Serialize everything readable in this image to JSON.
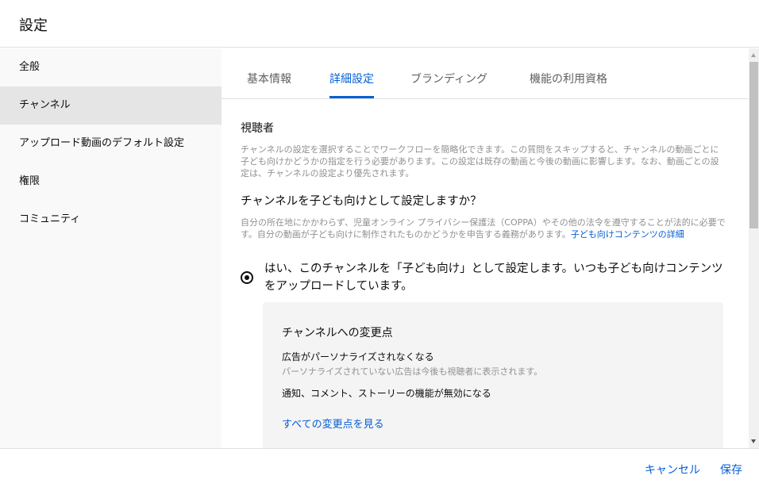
{
  "header": {
    "title": "設定"
  },
  "sidebar": {
    "items": [
      {
        "label": "全般"
      },
      {
        "label": "チャンネル"
      },
      {
        "label": "アップロード動画のデフォルト設定"
      },
      {
        "label": "権限"
      },
      {
        "label": "コミュニティ"
      }
    ],
    "active_index": 1
  },
  "tabs": [
    {
      "label": "基本情報"
    },
    {
      "label": "詳細設定"
    },
    {
      "label": "ブランディング"
    },
    {
      "label": "機能の利用資格"
    }
  ],
  "active_tab_index": 1,
  "audience": {
    "title": "視聴者",
    "description": "チャンネルの設定を選択することでワークフローを簡略化できます。この質問をスキップすると、チャンネルの動画ごとに子ども向けかどうかの指定を行う必要があります。この設定は既存の動画と今後の動画に影響します。なお、動画ごとの設定は、チャンネルの設定より優先されます。",
    "question": "チャンネルを子ども向けとして設定しますか？",
    "coppa_description": "自分の所在地にかかわらず、児童オンライン プライバシー保護法（COPPA）やその他の法令を遵守することが法的に必要です。自分の動画が子ども向けに制作されたものかどうかを申告する義務があります。",
    "coppa_link": "子ども向けコンテンツの詳細",
    "option_yes_label": "はい、このチャンネルを「子ども向け」として設定します。いつも子ども向けコンテンツをアップロードしています。",
    "option_yes_selected": true
  },
  "changes": {
    "title": "チャンネルへの変更点",
    "items": [
      {
        "title": "広告がパーソナライズされなくなる",
        "subtitle": "パーソナライズされていない広告は今後も視聴者に表示されます。"
      },
      {
        "title": "通知、コメント、ストーリーの機能が無効になる"
      }
    ],
    "see_all_link": "すべての変更点を見る"
  },
  "footer": {
    "cancel_label": "キャンセル",
    "save_label": "保存"
  },
  "icons": {
    "radio": "radio-selected-icon",
    "scroll_up": "scroll-up-arrow-icon",
    "scroll_down": "scroll-down-arrow-icon"
  },
  "colors": {
    "accent": "#065fd4",
    "sidebar_bg": "#f9f9f9",
    "sidebar_active_bg": "#e5e5e5",
    "secondary_text": "#909090",
    "box_bg": "#f4f4f4"
  }
}
